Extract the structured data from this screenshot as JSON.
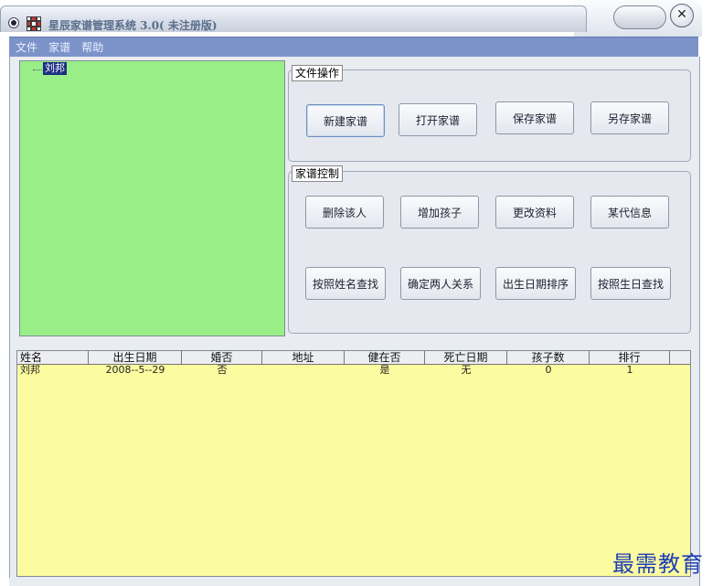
{
  "window": {
    "title": "星辰家谱管理系统 3.0( 未注册版)"
  },
  "menu": {
    "items": [
      "文件",
      "家谱",
      "帮助"
    ]
  },
  "tree": {
    "root": "刘邦"
  },
  "file_ops": {
    "label": "文件操作",
    "buttons": [
      "新建家谱",
      "打开家谱",
      "保存家谱",
      "另存家谱"
    ]
  },
  "genealogy_ctrl": {
    "label": "家谱控制",
    "row1": [
      "删除该人",
      "增加孩子",
      "更改资料",
      "某代信息"
    ],
    "row2": [
      "按照姓名查找",
      "确定两人关系",
      "出生日期排序",
      "按照生日查找"
    ]
  },
  "table": {
    "headers": [
      "姓名",
      "出生日期",
      "婚否",
      "地址",
      "健在否",
      "死亡日期",
      "孩子数",
      "排行"
    ],
    "rows": [
      [
        "刘邦",
        "2008--5--29",
        "否",
        "",
        "是",
        "无",
        "0",
        "1"
      ]
    ]
  },
  "watermark": "最需教育",
  "icons": {
    "system": "system-menu-icon",
    "app": "app-icon",
    "close": "close-icon"
  }
}
